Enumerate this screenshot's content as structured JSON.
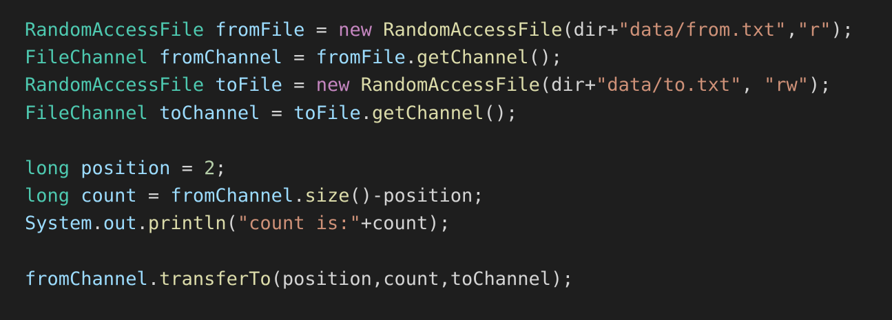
{
  "colors": {
    "background": "#1e1e1e",
    "type": "#4ec9b0",
    "variable": "#9cdcfe",
    "keyword": "#c586c0",
    "function": "#dcdcaa",
    "string": "#ce9178",
    "number": "#b5cea8",
    "plain": "#d4d4d4"
  },
  "lines": [
    [
      {
        "t": "RandomAccessFile",
        "c": "ty"
      },
      {
        "t": " ",
        "c": "pl"
      },
      {
        "t": "fromFile",
        "c": "vr"
      },
      {
        "t": " = ",
        "c": "pl"
      },
      {
        "t": "new",
        "c": "kw"
      },
      {
        "t": " ",
        "c": "pl"
      },
      {
        "t": "RandomAccessFile",
        "c": "fn"
      },
      {
        "t": "(dir+",
        "c": "pl"
      },
      {
        "t": "\"data/from.txt\"",
        "c": "st"
      },
      {
        "t": ",",
        "c": "pl"
      },
      {
        "t": "\"r\"",
        "c": "st"
      },
      {
        "t": ");",
        "c": "pl"
      }
    ],
    [
      {
        "t": "FileChannel",
        "c": "ty"
      },
      {
        "t": " ",
        "c": "pl"
      },
      {
        "t": "fromChannel",
        "c": "vr"
      },
      {
        "t": " = ",
        "c": "pl"
      },
      {
        "t": "fromFile",
        "c": "vr"
      },
      {
        "t": ".",
        "c": "pl"
      },
      {
        "t": "getChannel",
        "c": "fn"
      },
      {
        "t": "();",
        "c": "pl"
      }
    ],
    [
      {
        "t": "RandomAccessFile",
        "c": "ty"
      },
      {
        "t": " ",
        "c": "pl"
      },
      {
        "t": "toFile",
        "c": "vr"
      },
      {
        "t": " = ",
        "c": "pl"
      },
      {
        "t": "new",
        "c": "kw"
      },
      {
        "t": " ",
        "c": "pl"
      },
      {
        "t": "RandomAccessFile",
        "c": "fn"
      },
      {
        "t": "(dir+",
        "c": "pl"
      },
      {
        "t": "\"data/to.txt\"",
        "c": "st"
      },
      {
        "t": ", ",
        "c": "pl"
      },
      {
        "t": "\"rw\"",
        "c": "st"
      },
      {
        "t": ");",
        "c": "pl"
      }
    ],
    [
      {
        "t": "FileChannel",
        "c": "ty"
      },
      {
        "t": " ",
        "c": "pl"
      },
      {
        "t": "toChannel",
        "c": "vr"
      },
      {
        "t": " = ",
        "c": "pl"
      },
      {
        "t": "toFile",
        "c": "vr"
      },
      {
        "t": ".",
        "c": "pl"
      },
      {
        "t": "getChannel",
        "c": "fn"
      },
      {
        "t": "();",
        "c": "pl"
      }
    ],
    [],
    [
      {
        "t": "long",
        "c": "kd"
      },
      {
        "t": " ",
        "c": "pl"
      },
      {
        "t": "position",
        "c": "vr"
      },
      {
        "t": " = ",
        "c": "pl"
      },
      {
        "t": "2",
        "c": "nu"
      },
      {
        "t": ";",
        "c": "pl"
      }
    ],
    [
      {
        "t": "long",
        "c": "kd"
      },
      {
        "t": " ",
        "c": "pl"
      },
      {
        "t": "count",
        "c": "vr"
      },
      {
        "t": " = ",
        "c": "pl"
      },
      {
        "t": "fromChannel",
        "c": "vr"
      },
      {
        "t": ".",
        "c": "pl"
      },
      {
        "t": "size",
        "c": "fn"
      },
      {
        "t": "()-position;",
        "c": "pl"
      }
    ],
    [
      {
        "t": "System",
        "c": "vr"
      },
      {
        "t": ".",
        "c": "pl"
      },
      {
        "t": "out",
        "c": "vr"
      },
      {
        "t": ".",
        "c": "pl"
      },
      {
        "t": "println",
        "c": "fn"
      },
      {
        "t": "(",
        "c": "pl"
      },
      {
        "t": "\"count is:\"",
        "c": "st"
      },
      {
        "t": "+count);",
        "c": "pl"
      }
    ],
    [],
    [
      {
        "t": "fromChannel",
        "c": "vr"
      },
      {
        "t": ".",
        "c": "pl"
      },
      {
        "t": "transferTo",
        "c": "fn"
      },
      {
        "t": "(position,count,toChannel);",
        "c": "pl"
      }
    ]
  ]
}
